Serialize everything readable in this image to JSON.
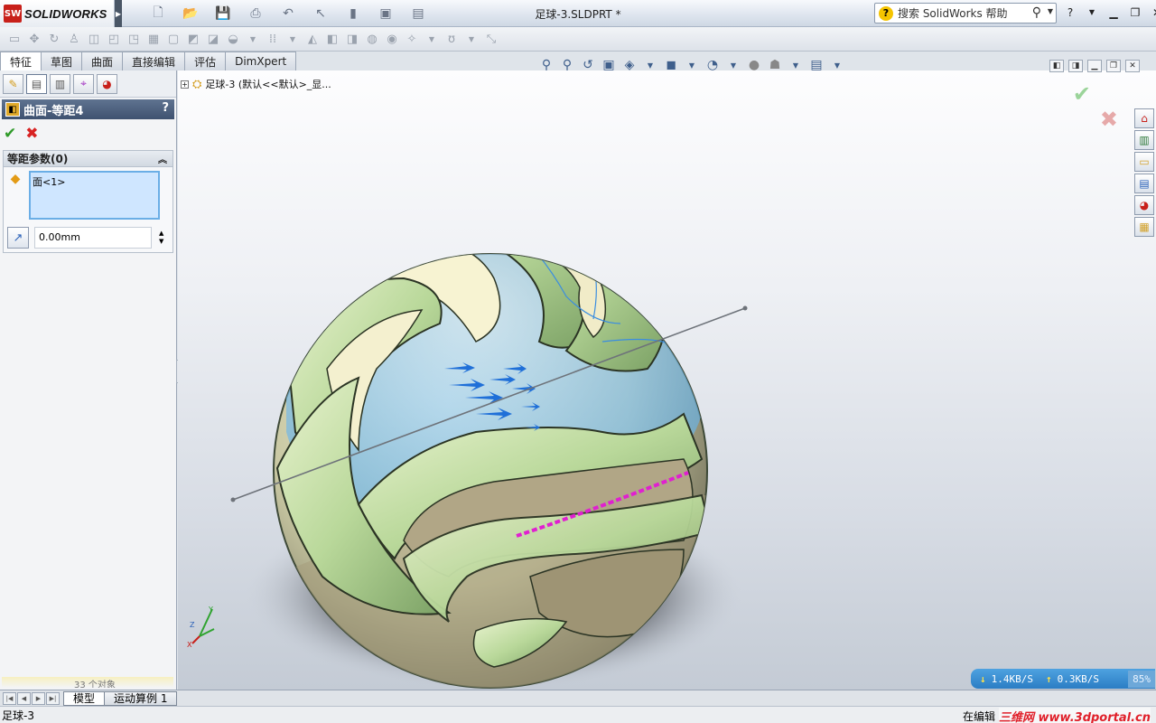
{
  "app": {
    "logo_mark": "SW",
    "logo_text": "SOLIDWORKS",
    "document_title": "足球-3.SLDPRT *",
    "search_placeholder": "搜索 SolidWorks 帮助",
    "help_label": "?"
  },
  "tabs": [
    "特征",
    "草图",
    "曲面",
    "直接编辑",
    "评估",
    "DimXpert"
  ],
  "active_tab_index": 0,
  "property_manager": {
    "title": "曲面-等距4",
    "help": "?",
    "group_title": "等距参数(0)",
    "selection_item": "面<1>",
    "distance_value": "0.00mm",
    "bottom_text": "33 个对象"
  },
  "viewport": {
    "tree_label": "足球-3 (默认<<默认>_显..."
  },
  "net_meter": {
    "download": "1.4KB/S",
    "upload": "0.3KB/S",
    "percent": "85%"
  },
  "bottom_tabs": [
    "模型",
    "运动算例 1"
  ],
  "status": {
    "left": "足球-3",
    "right": "在编辑",
    "watermark": "三维网 www.3dportal.cn"
  },
  "colors": {
    "accent_blue": "#4ea2e0",
    "ok_green": "#2f9a29",
    "cancel_red": "#d82323",
    "selection_magenta": "#e020d0"
  }
}
